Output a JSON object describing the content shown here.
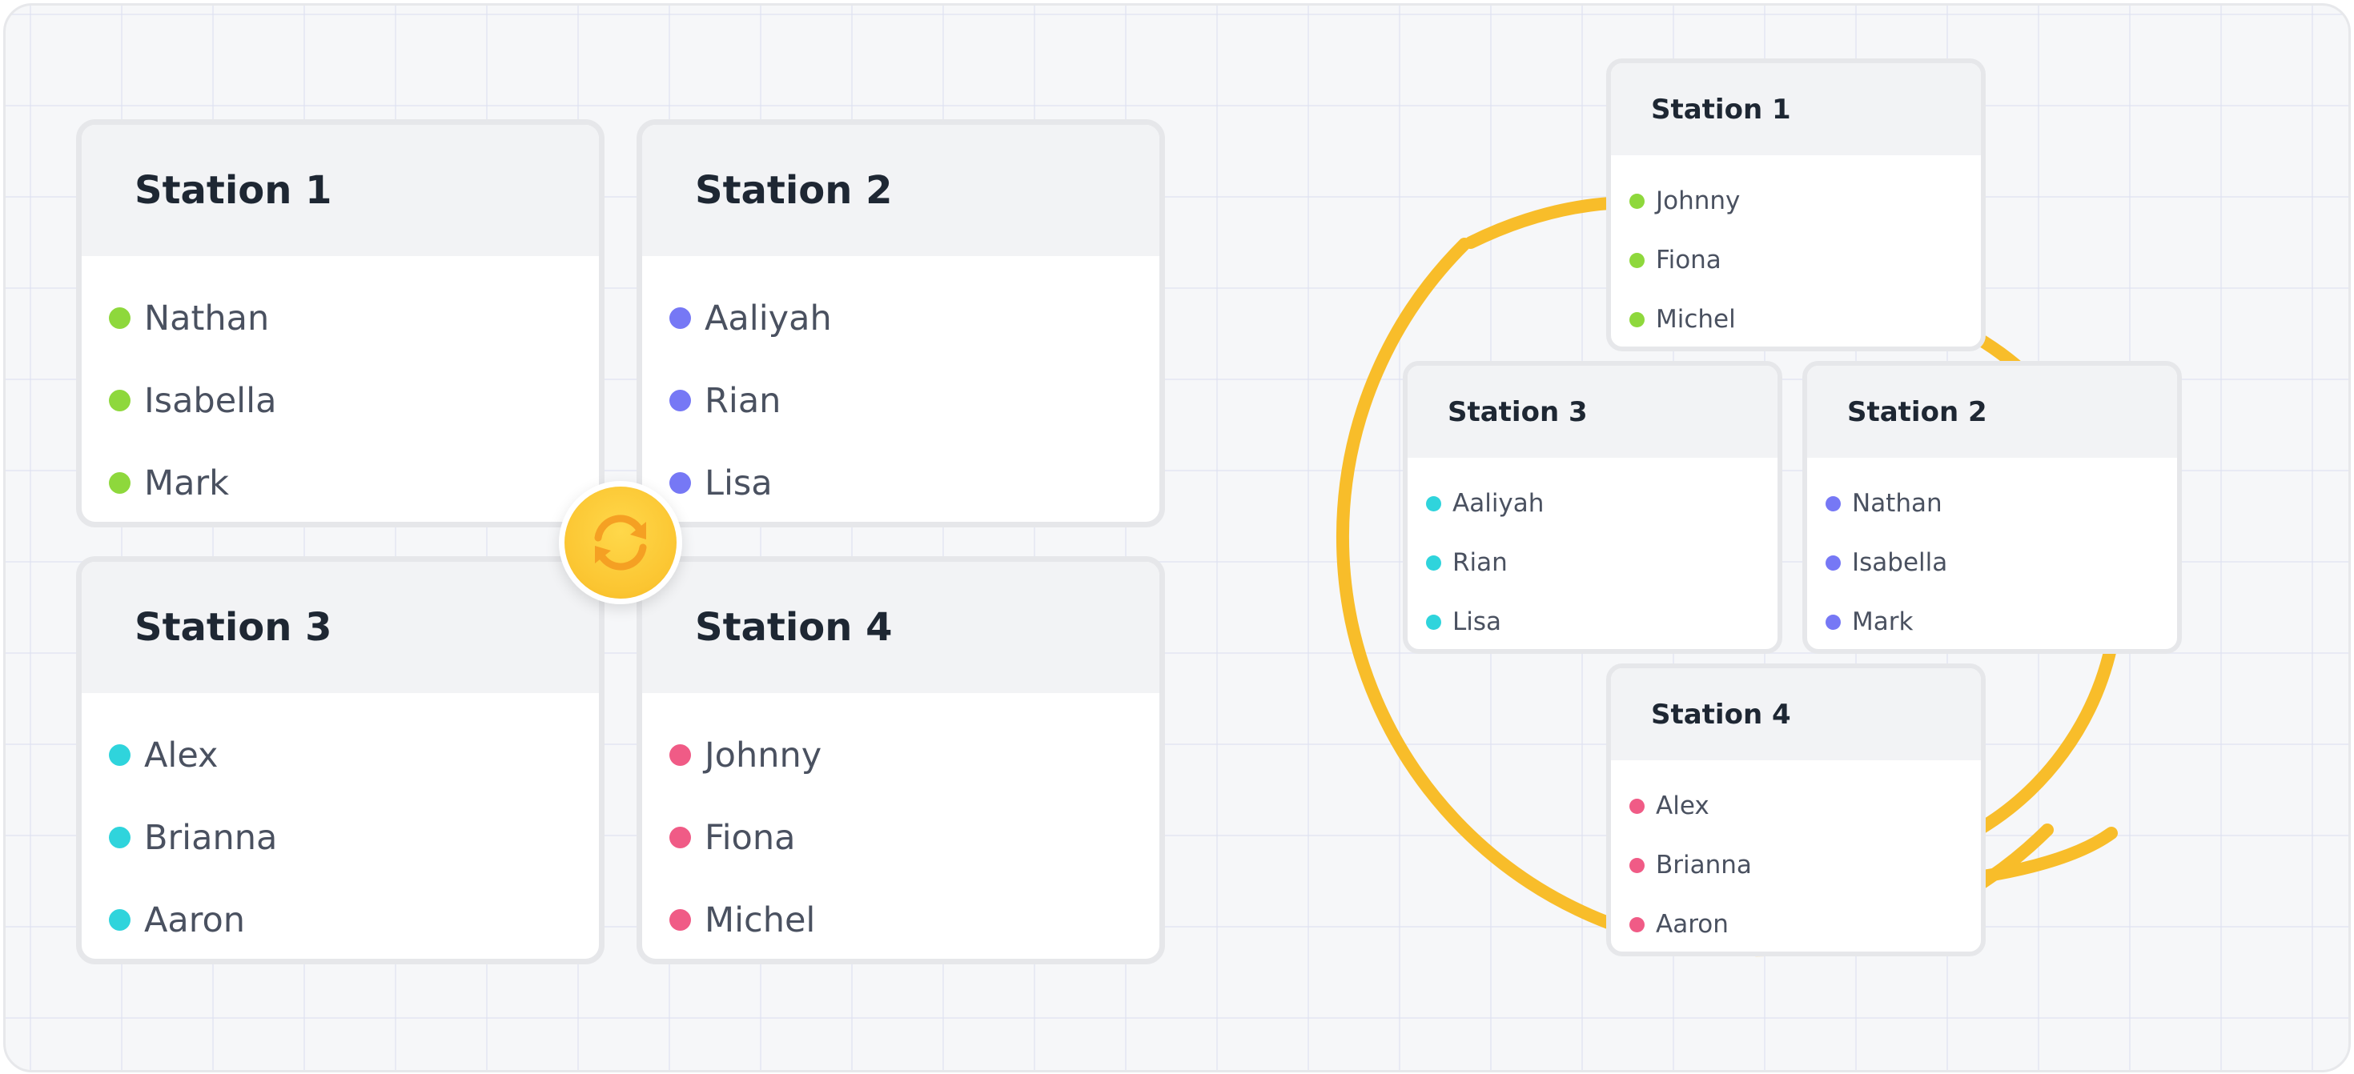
{
  "colors": {
    "green": "#8ed83c",
    "blue": "#7678f5",
    "teal": "#2fd4dc",
    "pink": "#f05b86",
    "ring": "#f8bd2a",
    "swap_button": "#fbc531"
  },
  "left_grid": {
    "cards": [
      {
        "title": "Station 1",
        "color": "green",
        "members": [
          "Nathan",
          "Isabella",
          "Mark"
        ]
      },
      {
        "title": "Station 2",
        "color": "blue",
        "members": [
          "Aaliyah",
          "Rian",
          "Lisa"
        ]
      },
      {
        "title": "Station 3",
        "color": "teal",
        "members": [
          "Alex",
          "Brianna",
          "Aaron"
        ]
      },
      {
        "title": "Station 4",
        "color": "pink",
        "members": [
          "Johnny",
          "Fiona",
          "Michel"
        ]
      }
    ]
  },
  "swap_icon": "rotate-arrows-icon",
  "right_cycle": {
    "cards": [
      {
        "title": "Station 1",
        "color": "green",
        "members": [
          "Johnny",
          "Fiona",
          "Michel"
        ]
      },
      {
        "title": "Station 3",
        "color": "teal",
        "members": [
          "Aaliyah",
          "Rian",
          "Lisa"
        ]
      },
      {
        "title": "Station 2",
        "color": "blue",
        "members": [
          "Nathan",
          "Isabella",
          "Mark"
        ]
      },
      {
        "title": "Station 4",
        "color": "pink",
        "members": [
          "Alex",
          "Brianna",
          "Aaron"
        ]
      }
    ]
  }
}
